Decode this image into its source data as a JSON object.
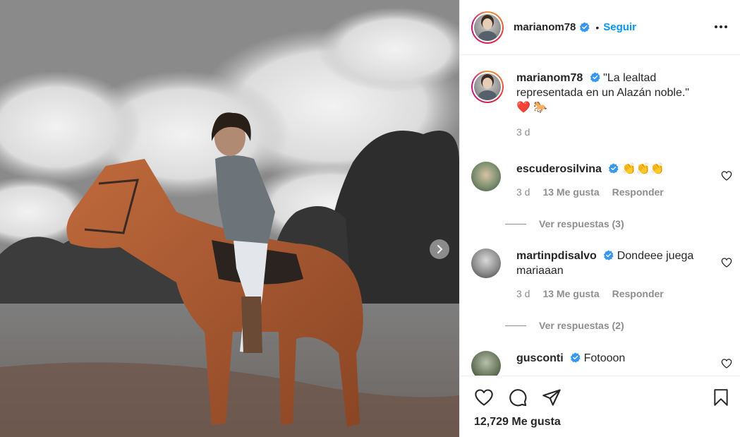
{
  "post": {
    "username": "marianom78",
    "follow_label": "Seguir",
    "separator": "•"
  },
  "caption": {
    "username": "marianom78",
    "text": "\"La lealtad representada en un Alazán noble.\"",
    "emojis": "❤️ 🐎",
    "time": "3 d"
  },
  "comments": [
    {
      "username": "escuderosilvina",
      "text": "👏👏👏",
      "time": "3 d",
      "likes": "13 Me gusta",
      "reply": "Responder",
      "view_replies": "Ver respuestas (3)"
    },
    {
      "username": "martinpdisalvo",
      "text": "Dondeee juega mariaaan",
      "time": "3 d",
      "likes": "13 Me gusta",
      "reply": "Responder",
      "view_replies": "Ver respuestas (2)"
    },
    {
      "username": "gusconti",
      "text": "Fotooon"
    }
  ],
  "footer": {
    "likes_count": "12,729 Me gusta"
  },
  "colors": {
    "link_blue": "#0095f6",
    "verified_blue": "#3897f0",
    "muted": "#8e8e8e",
    "heart_red": "#e0245e"
  },
  "icons": {
    "verified": "verified-badge-icon",
    "more": "more-horizontal-icon",
    "carousel_next": "chevron-right-icon",
    "like": "heart-outline-icon",
    "comment": "comment-bubble-icon",
    "share": "paper-plane-icon",
    "save": "bookmark-icon"
  }
}
